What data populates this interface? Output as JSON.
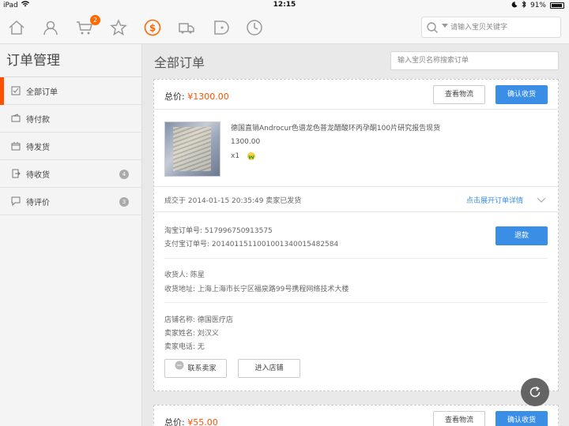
{
  "status_bar": {
    "device": "iPad",
    "time": "12:15",
    "battery": "91%"
  },
  "top_nav": {
    "cart_badge": "2",
    "search_placeholder": "请输入宝贝关键字",
    "accent_color": "#ff6a00"
  },
  "sidebar": {
    "title": "订单管理",
    "items": [
      {
        "label": "全部订单",
        "icon": "checkbox-icon",
        "count": ""
      },
      {
        "label": "待付款",
        "icon": "wallet-icon",
        "count": ""
      },
      {
        "label": "待发货",
        "icon": "box-icon",
        "count": ""
      },
      {
        "label": "待收货",
        "icon": "receive-icon",
        "count": "4"
      },
      {
        "label": "待评价",
        "icon": "comment-icon",
        "count": "3"
      }
    ]
  },
  "main": {
    "title": "全部订单",
    "search_placeholder": "输入宝贝名称搜索订单",
    "orders": [
      {
        "total_label": "总价:",
        "total": "¥1300.00",
        "btn_logistics": "查看物流",
        "btn_confirm": "确认收货",
        "product_title": "德国直销Androcur色谱龙色普龙醋酸环丙孕酮100片研究报告现货",
        "product_price": "1300.00",
        "product_qty": "x1",
        "deal_text": "成交于 2014-01-15 20:35:49  卖家已发货",
        "expand_link": "点击展开订单详情",
        "taobao_order": "淘宝订单号: 517996750913575",
        "alipay_order": "支付宝订单号: 2014011511001001340015482584",
        "btn_refund": "退款",
        "receiver": "收货人: 陈星",
        "address": "收货地址: 上海上海市长宁区福泉路99号携程网络技术大楼",
        "shop_name": "店铺名称: 德国医疗店",
        "seller_name": "卖家姓名: 刘汉义",
        "seller_phone": "卖家电话: 无",
        "btn_contact": "联系卖家",
        "btn_shop": "进入店铺"
      },
      {
        "total_label": "总价:",
        "total": "¥55.00",
        "btn_logistics": "查看物流",
        "btn_confirm": "确认收货"
      }
    ]
  },
  "colors": {
    "price": "#ff5000",
    "primary_button": "#3a8ee6"
  }
}
